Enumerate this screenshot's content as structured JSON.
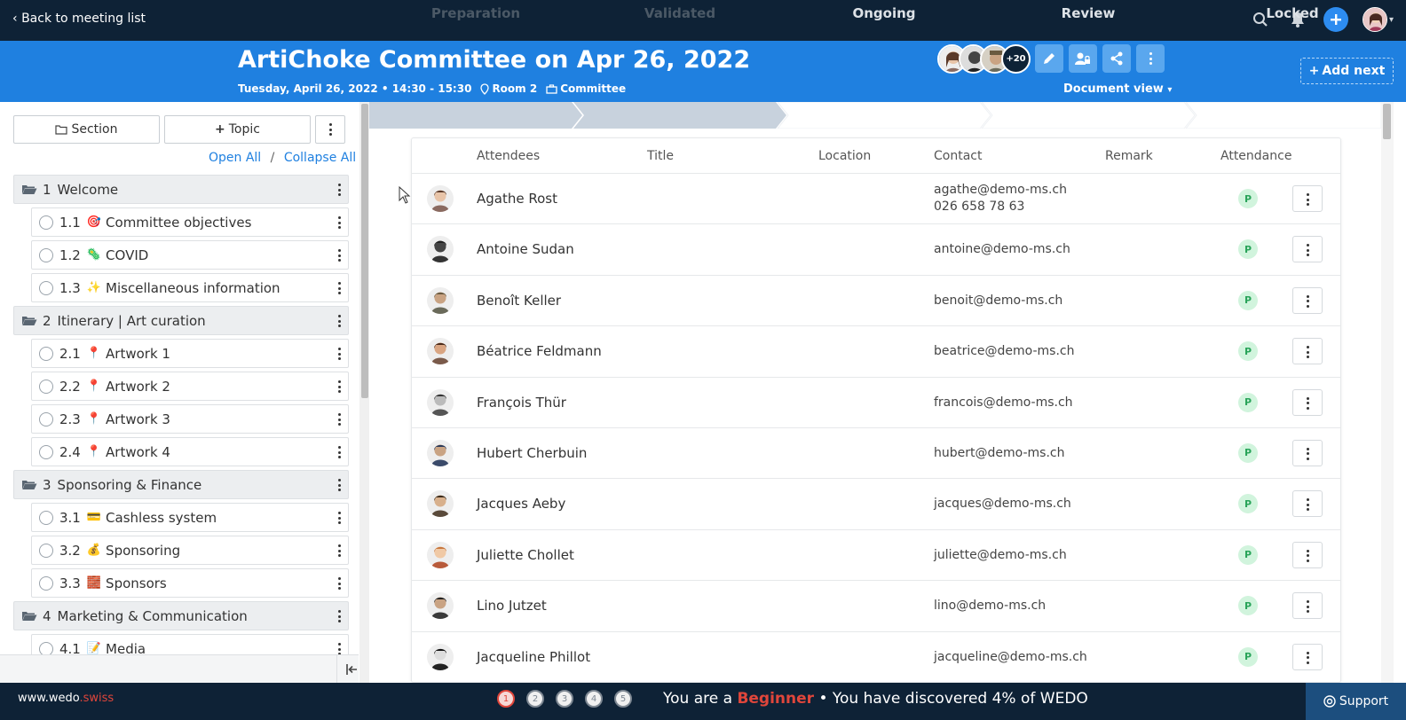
{
  "topbar": {
    "back_label": "Back to meeting list"
  },
  "header": {
    "title": "ArtiChoke Committee on Apr 26, 2022",
    "date_time": "Tuesday, April 26, 2022 • 14:30 - 15:30",
    "room": "Room 2",
    "committee": "Committee",
    "more_attendees": "+20",
    "document_view": "Document view",
    "add_next": "Add next"
  },
  "sidebar": {
    "section_btn": "Section",
    "topic_btn": "Topic",
    "open_all": "Open All",
    "separator": "/",
    "collapse_all": "Collapse All",
    "tree": [
      {
        "type": "section",
        "num": "1",
        "label": "Welcome"
      },
      {
        "type": "topic",
        "num": "1.1",
        "emoji": "🎯",
        "label": "Committee objectives"
      },
      {
        "type": "topic",
        "num": "1.2",
        "emoji": "🦠",
        "label": "COVID"
      },
      {
        "type": "topic",
        "num": "1.3",
        "emoji": "✨",
        "label": "Miscellaneous information"
      },
      {
        "type": "section",
        "num": "2",
        "label": "Itinerary | Art curation"
      },
      {
        "type": "topic",
        "num": "2.1",
        "emoji": "📍",
        "label": "Artwork 1"
      },
      {
        "type": "topic",
        "num": "2.2",
        "emoji": "📍",
        "label": "Artwork 2"
      },
      {
        "type": "topic",
        "num": "2.3",
        "emoji": "📍",
        "label": "Artwork 3"
      },
      {
        "type": "topic",
        "num": "2.4",
        "emoji": "📍",
        "label": "Artwork 4"
      },
      {
        "type": "section",
        "num": "3",
        "label": "Sponsoring & Finance"
      },
      {
        "type": "topic",
        "num": "3.1",
        "emoji": "💳",
        "label": "Cashless system"
      },
      {
        "type": "topic",
        "num": "3.2",
        "emoji": "💰",
        "label": "Sponsoring"
      },
      {
        "type": "topic",
        "num": "3.3",
        "emoji": "🧱",
        "label": "Sponsors"
      },
      {
        "type": "section",
        "num": "4",
        "label": "Marketing & Communication"
      },
      {
        "type": "topic",
        "num": "4.1",
        "emoji": "📝",
        "label": "Media"
      }
    ]
  },
  "workflow": {
    "steps": [
      "Preparation",
      "Validated",
      "Ongoing",
      "Review",
      "Locked"
    ],
    "current": "Validated"
  },
  "table": {
    "headers": [
      "Attendees",
      "Title",
      "Location",
      "Contact",
      "Remark",
      "Attendance"
    ],
    "rows": [
      {
        "name": "Agathe Rost",
        "contact": "agathe@demo-ms.ch",
        "phone": "026 658 78 63",
        "attendance": "P"
      },
      {
        "name": "Antoine Sudan",
        "contact": "antoine@demo-ms.ch",
        "phone": "",
        "attendance": "P"
      },
      {
        "name": "Benoît Keller",
        "contact": "benoit@demo-ms.ch",
        "phone": "",
        "attendance": "P"
      },
      {
        "name": "Béatrice Feldmann",
        "contact": "beatrice@demo-ms.ch",
        "phone": "",
        "attendance": "P"
      },
      {
        "name": "François Thür",
        "contact": "francois@demo-ms.ch",
        "phone": "",
        "attendance": "P"
      },
      {
        "name": "Hubert Cherbuin",
        "contact": "hubert@demo-ms.ch",
        "phone": "",
        "attendance": "P"
      },
      {
        "name": "Jacques Aeby",
        "contact": "jacques@demo-ms.ch",
        "phone": "",
        "attendance": "P"
      },
      {
        "name": "Juliette Chollet",
        "contact": "juliette@demo-ms.ch",
        "phone": "",
        "attendance": "P"
      },
      {
        "name": "Lino Jutzet",
        "contact": "lino@demo-ms.ch",
        "phone": "",
        "attendance": "P"
      },
      {
        "name": "Jacqueline Phillot",
        "contact": "jacqueline@demo-ms.ch",
        "phone": "",
        "attendance": "P"
      }
    ]
  },
  "footer": {
    "brand_main": "www.wedo",
    "brand_suffix": ".swiss",
    "dots": [
      "1",
      "2",
      "3",
      "4",
      "5"
    ],
    "msg_prefix": "You are a",
    "level": "Beginner",
    "msg_suffix": "• You have discovered 4% of WEDO",
    "support": "Support"
  },
  "colors": {
    "topbar": "#0e2236",
    "header": "#1f80e0",
    "accent_red": "#e0463b",
    "attendance_green": "#2aa45a"
  }
}
